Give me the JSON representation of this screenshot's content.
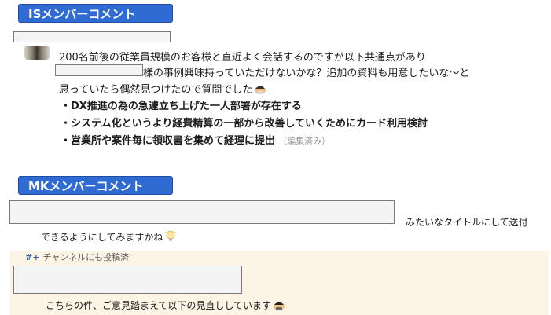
{
  "is_section": {
    "badge": "ISメンバーコメント",
    "lines": [
      "200名前後の従業員規模のお客様と直近よく会話するのですが以下共通点があり",
      "様の事例興味持っていただけないかな？追加の資料も用意したいな〜と",
      "思っていたら偶然見つけたので質問でした"
    ],
    "bullets": [
      "・DX推進の為の急遽立ち上げた一人部署が存在する",
      "・システム化というより経費精算の一部から改善していくためにカード利用検討",
      "・営業所や案件毎に領収書を集めて経理に提出"
    ],
    "edited_label": "（編集済み）"
  },
  "mk_section": {
    "badge": "MKメンバーコメント",
    "title_suffix": "みたいなタイトルにして送付",
    "line2": "できるようにしてみますかね",
    "channel_note": "チャンネルにも投稿済",
    "channel_icon": "#+",
    "reply_line": "こちらの件、ご意見踏まえて以下の見直ししています"
  },
  "colors": {
    "badge_bg": "#2f6bd2",
    "thread_bg": "#fcf4e4"
  },
  "icons": {
    "emoji_1": "bowing-person-emoji",
    "emoji_2": "light-bulb-emoji",
    "emoji_3": "bowing-person-emoji"
  }
}
